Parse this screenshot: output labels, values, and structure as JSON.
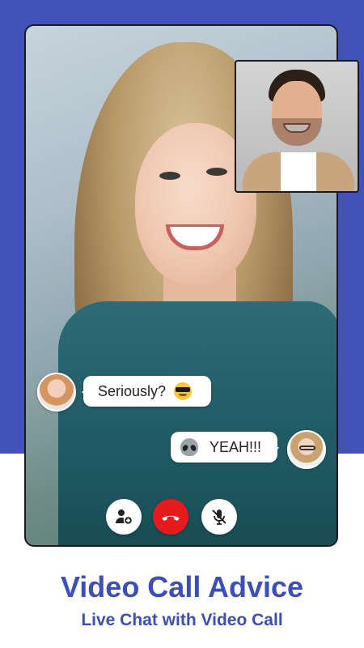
{
  "colors": {
    "brand_blue": "#4153b8",
    "end_call_red": "#e61c1c",
    "heading_blue": "#3c4fb8"
  },
  "chat": {
    "incoming_message": "Seriously?",
    "incoming_emoji": "sunglasses-emoji",
    "outgoing_message": "YEAH!!!",
    "outgoing_emoji": "alien-emoji"
  },
  "controls": [
    {
      "name": "add-user-icon"
    },
    {
      "name": "end-call-icon"
    },
    {
      "name": "mute-microphone-icon"
    }
  ],
  "footer": {
    "title": "Video Call Advice",
    "subtitle": "Live Chat with Video Call"
  }
}
